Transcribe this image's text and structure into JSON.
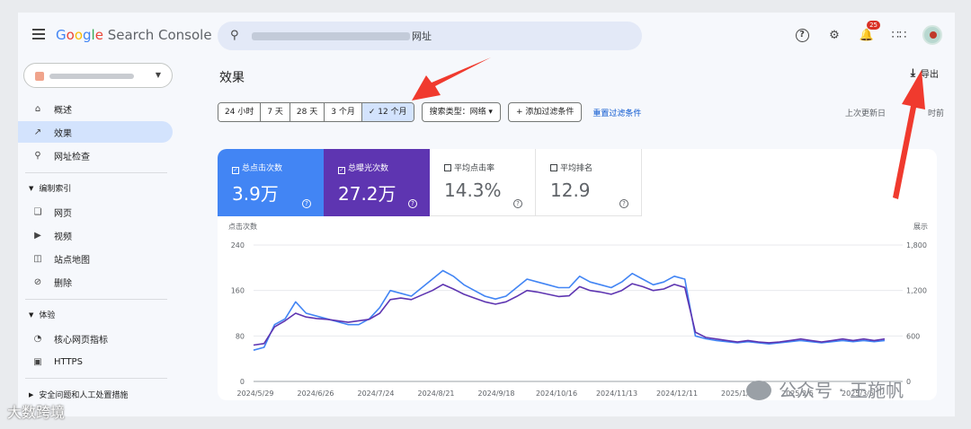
{
  "brand": {
    "word1_letters": [
      "G",
      "o",
      "o",
      "g",
      "l",
      "e"
    ],
    "suffix": "Search Console"
  },
  "search": {
    "url_suffix": "网址"
  },
  "notifications_count": "25",
  "nav": {
    "overview": "概述",
    "performance": "效果",
    "url_inspection": "网址检查",
    "indexing_section": "编制索引",
    "pages": "网页",
    "videos": "视频",
    "sitemaps": "站点地图",
    "removals": "删除",
    "experience_section": "体验",
    "core_web_vitals": "核心网页指标",
    "https": "HTTPS",
    "security_section": "安全问题和人工处置措施"
  },
  "page": {
    "title": "效果",
    "export_label": "导出"
  },
  "date_ranges": [
    {
      "label": "24 小时",
      "selected": false
    },
    {
      "label": "7 天",
      "selected": false
    },
    {
      "label": "28 天",
      "selected": false
    },
    {
      "label": "3 个月",
      "selected": false
    },
    {
      "label": "✓ 12 个月",
      "selected": true
    }
  ],
  "filters": {
    "search_type": "搜索类型：网络 ▾",
    "add_filter": "+ 添加过滤条件",
    "reset": "重置过滤条件"
  },
  "last_updated": {
    "prefix": "上次更新日",
    "suffix": "时前"
  },
  "metrics": [
    {
      "label": "总点击次数",
      "value": "3.9万",
      "checked": true,
      "color": "#4285f4"
    },
    {
      "label": "总曝光次数",
      "value": "27.2万",
      "checked": true,
      "color": "#5e35b1"
    },
    {
      "label": "平均点击率",
      "value": "14.3%",
      "checked": false
    },
    {
      "label": "平均排名",
      "value": "12.9",
      "checked": false
    }
  ],
  "chart_data": {
    "type": "line",
    "left_axis_label": "点击次数",
    "right_axis_label": "展示",
    "left_ticks": [
      "240",
      "160",
      "80",
      "0"
    ],
    "right_ticks": [
      "1,800",
      "1,200",
      "600",
      "0"
    ],
    "left_ylim": [
      0,
      240
    ],
    "right_ylim": [
      0,
      1800
    ],
    "x_ticks": [
      "2024/5/29",
      "2024/6/26",
      "2024/7/24",
      "2024/8/21",
      "2024/9/18",
      "2024/10/16",
      "2024/11/13",
      "2024/12/11",
      "2025/1/8",
      "2025/2/5",
      "2025/3/5"
    ],
    "grid": true,
    "series": [
      {
        "name": "总点击次数",
        "color": "#4285f4",
        "axis": "left",
        "values": [
          55,
          60,
          100,
          110,
          140,
          120,
          115,
          110,
          105,
          100,
          100,
          110,
          130,
          160,
          155,
          150,
          165,
          180,
          195,
          185,
          170,
          160,
          150,
          145,
          150,
          165,
          180,
          175,
          170,
          165,
          165,
          185,
          175,
          170,
          165,
          175,
          190,
          180,
          170,
          175,
          185,
          180,
          80,
          75,
          72,
          70,
          68,
          70,
          68,
          66,
          68,
          70,
          72,
          70,
          68,
          70,
          72,
          70,
          72,
          70,
          72
        ]
      },
      {
        "name": "总曝光次数",
        "color": "#5e35b1",
        "axis": "right",
        "values": [
          480,
          500,
          720,
          800,
          900,
          850,
          830,
          820,
          800,
          780,
          800,
          820,
          900,
          1080,
          1100,
          1080,
          1140,
          1200,
          1280,
          1220,
          1150,
          1100,
          1050,
          1020,
          1050,
          1120,
          1200,
          1180,
          1150,
          1120,
          1130,
          1250,
          1200,
          1180,
          1150,
          1200,
          1290,
          1250,
          1200,
          1220,
          1280,
          1240,
          650,
          580,
          560,
          540,
          520,
          540,
          520,
          510,
          520,
          540,
          560,
          540,
          520,
          540,
          560,
          540,
          560,
          540,
          560
        ]
      }
    ]
  },
  "watermarks": {
    "wechat": "公众号 · 王施帆",
    "site": "大数跨境"
  }
}
